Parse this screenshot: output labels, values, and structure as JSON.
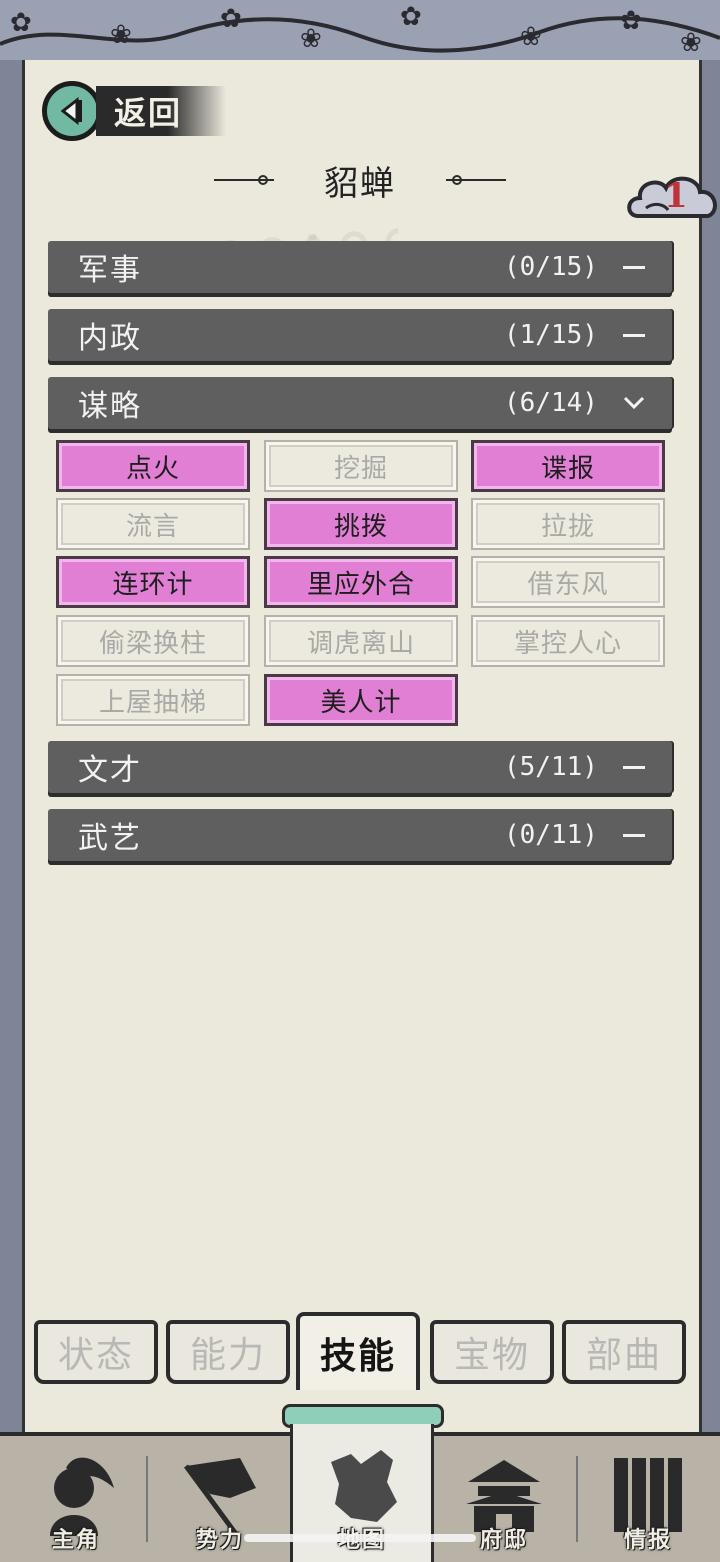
{
  "header": {
    "back_label": "返回",
    "title": "貂蝉",
    "badge_count": "1"
  },
  "categories": [
    {
      "name": "军事",
      "count": "(0/15)",
      "state": "collapsed"
    },
    {
      "name": "内政",
      "count": "(1/15)",
      "state": "collapsed"
    },
    {
      "name": "谋略",
      "count": "(6/14)",
      "state": "expanded"
    },
    {
      "name": "文才",
      "count": "(5/11)",
      "state": "collapsed"
    },
    {
      "name": "武艺",
      "count": "(0/11)",
      "state": "collapsed"
    }
  ],
  "skills": [
    {
      "label": "点火",
      "learned": true
    },
    {
      "label": "挖掘",
      "learned": false
    },
    {
      "label": "谍报",
      "learned": true
    },
    {
      "label": "流言",
      "learned": false
    },
    {
      "label": "挑拨",
      "learned": true
    },
    {
      "label": "拉拢",
      "learned": false
    },
    {
      "label": "连环计",
      "learned": true
    },
    {
      "label": "里应外合",
      "learned": true
    },
    {
      "label": "借东风",
      "learned": false
    },
    {
      "label": "偷梁换柱",
      "learned": false
    },
    {
      "label": "调虎离山",
      "learned": false
    },
    {
      "label": "掌控人心",
      "learned": false
    },
    {
      "label": "上屋抽梯",
      "learned": false
    },
    {
      "label": "美人计",
      "learned": true
    }
  ],
  "tabs": [
    {
      "label": "状态",
      "active": false
    },
    {
      "label": "能力",
      "active": false
    },
    {
      "label": "技能",
      "active": true
    },
    {
      "label": "宝物",
      "active": false
    },
    {
      "label": "部曲",
      "active": false
    }
  ],
  "bottom_nav": [
    {
      "label": "主角",
      "icon": "hero-icon",
      "active": false
    },
    {
      "label": "势力",
      "icon": "flag-icon",
      "active": false
    },
    {
      "label": "地图",
      "icon": "map-icon",
      "active": true
    },
    {
      "label": "府邸",
      "icon": "mansion-icon",
      "active": false
    },
    {
      "label": "情报",
      "icon": "scroll-icon",
      "active": false
    }
  ],
  "colors": {
    "learned_skill": "#e07fd4",
    "category_bar": "#5f5f5f",
    "paper": "#ebe8dc",
    "back_button": "#72b9a3",
    "badge_number": "#c0323a"
  }
}
